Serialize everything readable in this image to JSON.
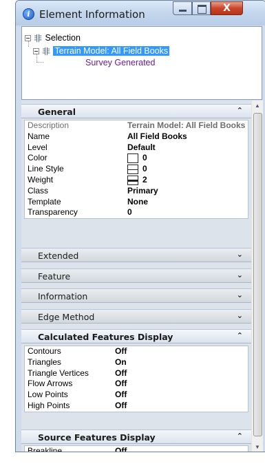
{
  "window": {
    "title": "Element Information",
    "buttons": {
      "minimize": "minimize",
      "maximize": "maximize",
      "close": "X"
    }
  },
  "tree": {
    "root": {
      "label": "Selection"
    },
    "child": {
      "label": "Terrain Model: All Field Books"
    },
    "grandchild": {
      "label": "Survey Generated"
    }
  },
  "sections": {
    "general": {
      "title": "General",
      "rows": [
        {
          "name": "Description",
          "value": "Terrain Model: All Field Books"
        },
        {
          "name": "Name",
          "value": "All Field Books"
        },
        {
          "name": "Level",
          "value": "Default"
        },
        {
          "name": "Color",
          "value": "0"
        },
        {
          "name": "Line Style",
          "value": "0"
        },
        {
          "name": "Weight",
          "value": "2"
        },
        {
          "name": "Class",
          "value": "Primary"
        },
        {
          "name": "Template",
          "value": "None"
        },
        {
          "name": "Transparency",
          "value": "0"
        }
      ]
    },
    "extended": {
      "title": "Extended"
    },
    "feature": {
      "title": "Feature"
    },
    "information": {
      "title": "Information"
    },
    "edge_method": {
      "title": "Edge Method"
    },
    "calculated": {
      "title": "Calculated Features Display",
      "rows": [
        {
          "name": "Contours",
          "value": "Off"
        },
        {
          "name": "Triangles",
          "value": "On"
        },
        {
          "name": "Triangle Vertices",
          "value": "Off"
        },
        {
          "name": "Flow Arrows",
          "value": "Off"
        },
        {
          "name": "Low Points",
          "value": "Off"
        },
        {
          "name": "High Points",
          "value": "Off"
        }
      ]
    },
    "source": {
      "title": "Source Features Display",
      "rows": [
        {
          "name": "Breakline",
          "value": "Off"
        }
      ]
    }
  },
  "icons": {
    "title": "info-icon",
    "tree_node": "tree-node-icon",
    "expanded_chevron": "chevron-up-icon",
    "collapsed_chevron": "chevron-down-icon"
  },
  "colors": {
    "selection_highlight": "#3399ff",
    "child_text": "#6a1b9a",
    "close_button": "#c9462c"
  }
}
